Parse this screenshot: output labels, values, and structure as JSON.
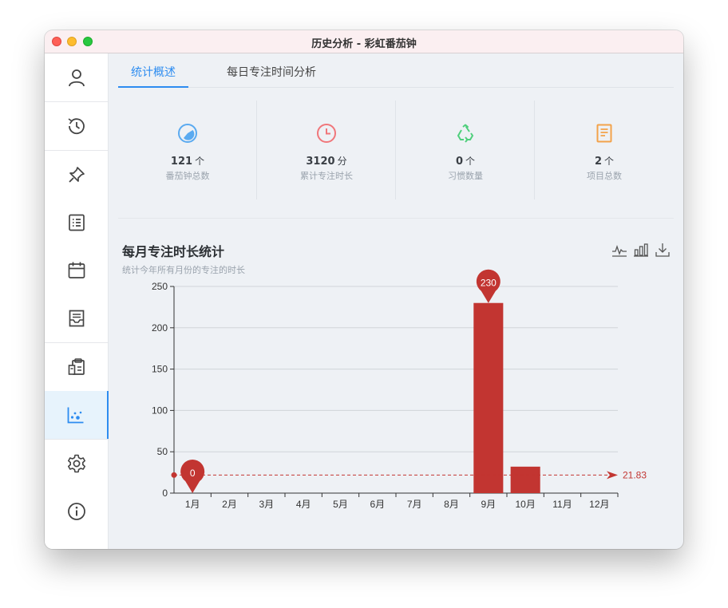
{
  "window": {
    "title": "历史分析 - 彩虹番茄钟"
  },
  "sidebar": {
    "items": [
      {
        "icon": "user-icon"
      },
      {
        "icon": "history-clock-icon"
      },
      {
        "icon": "pin-icon"
      },
      {
        "icon": "list-icon"
      },
      {
        "icon": "calendar-icon"
      },
      {
        "icon": "inbox-check-icon"
      },
      {
        "icon": "clipboard-icon"
      },
      {
        "icon": "scatter-chart-icon",
        "active": true
      },
      {
        "icon": "settings-gear-icon"
      },
      {
        "icon": "info-icon"
      }
    ]
  },
  "tabs": [
    {
      "label": "统计概述",
      "active": true
    },
    {
      "label": "每日专注时间分析",
      "active": false
    }
  ],
  "stats": [
    {
      "value": "121",
      "unit": "个",
      "label": "番茄钟总数",
      "icon": "pie-icon",
      "color": "#5aaaf0"
    },
    {
      "value": "3120",
      "unit": "分",
      "label": "累计专注时长",
      "icon": "clock-icon",
      "color": "#f0767a"
    },
    {
      "value": "0",
      "unit": "个",
      "label": "习惯数量",
      "icon": "recycle-icon",
      "color": "#4fcf7c"
    },
    {
      "value": "2",
      "unit": "个",
      "label": "项目总数",
      "icon": "document-icon",
      "color": "#f3a24a"
    }
  ],
  "chart_section": {
    "title": "每月专注时长统计",
    "subtitle": "统计今年所有月份的专注的时长",
    "toolbox": [
      "line-chart-icon",
      "bar-chart-icon",
      "download-icon"
    ]
  },
  "chart_data": {
    "type": "bar",
    "categories": [
      "1月",
      "2月",
      "3月",
      "4月",
      "5月",
      "6月",
      "7月",
      "8月",
      "9月",
      "10月",
      "11月",
      "12月"
    ],
    "values": [
      0,
      0,
      0,
      0,
      0,
      0,
      0,
      0,
      230,
      32,
      0,
      0
    ],
    "ylim": [
      0,
      250
    ],
    "yticks": [
      0,
      50,
      100,
      150,
      200,
      250
    ],
    "bar_color": "#c23531",
    "mark_points": [
      {
        "label": "230",
        "category": "9月",
        "value": 230
      },
      {
        "label": "0",
        "category": "1月",
        "value": 0
      }
    ],
    "mark_line": {
      "label": "21.83",
      "value": 21.83
    },
    "grid": true
  }
}
